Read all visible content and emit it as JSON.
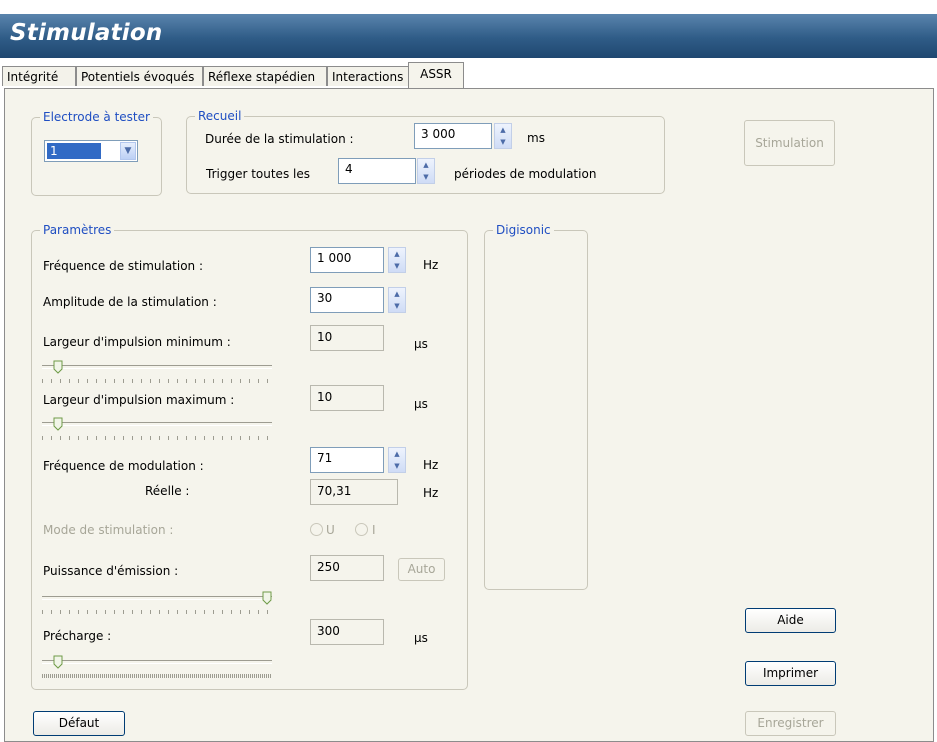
{
  "window": {
    "title": "Stimulation"
  },
  "tabs": [
    {
      "label": "Intégrité"
    },
    {
      "label": "Potentiels évoqués"
    },
    {
      "label": "Réflexe stapédien"
    },
    {
      "label": "Interactions"
    },
    {
      "label": "ASSR"
    }
  ],
  "electrode": {
    "legend": "Electrode à tester",
    "value": "1"
  },
  "recueil": {
    "legend": "Recueil",
    "duree_label": "Durée de la stimulation :",
    "duree_value": "3 000",
    "duree_unit": "ms",
    "trigger_label": "Trigger toutes les",
    "trigger_value": "4",
    "trigger_unit": "périodes de modulation"
  },
  "parametres": {
    "legend": "Paramètres",
    "freq_stim_label": "Fréquence de stimulation :",
    "freq_stim_value": "1 000",
    "freq_stim_unit": "Hz",
    "amplitude_label": "Amplitude de la stimulation :",
    "amplitude_value": "30",
    "largeur_min_label": "Largeur d'impulsion minimum :",
    "largeur_min_value": "10",
    "largeur_min_unit": "µs",
    "largeur_max_label": "Largeur d'impulsion maximum :",
    "largeur_max_value": "10",
    "largeur_max_unit": "µs",
    "freq_mod_label": "Fréquence de modulation :",
    "freq_mod_value": "71",
    "freq_mod_unit": "Hz",
    "reelle_label": "Réelle :",
    "reelle_value": "70,31",
    "reelle_unit": "Hz",
    "mode_label": "Mode de stimulation :",
    "mode_u": "U",
    "mode_i": "I",
    "puissance_label": "Puissance d'émission :",
    "puissance_value": "250",
    "auto_label": "Auto",
    "precharge_label": "Précharge :",
    "precharge_value": "300",
    "precharge_unit": "µs"
  },
  "digisonic": {
    "legend": "Digisonic"
  },
  "buttons": {
    "stimulation": "Stimulation",
    "aide": "Aide",
    "imprimer": "Imprimer",
    "enregistrer": "Enregistrer",
    "defaut": "Défaut"
  },
  "sliders": {
    "largeur_min_level": 0.05,
    "largeur_max_level": 0.05,
    "puissance_level": 1.0,
    "precharge_level": 0.05
  },
  "icons": {
    "spin_up": "chevron-up-icon",
    "spin_down": "chevron-down-icon",
    "combo_arrow": "chevron-down-icon",
    "slider_thumb": "slider-thumb-icon"
  },
  "colors": {
    "title_bar": "#2f5c87",
    "legend_text": "#1f4ec2",
    "panel_bg": "#f5f4ec",
    "selection": "#316ac5"
  }
}
